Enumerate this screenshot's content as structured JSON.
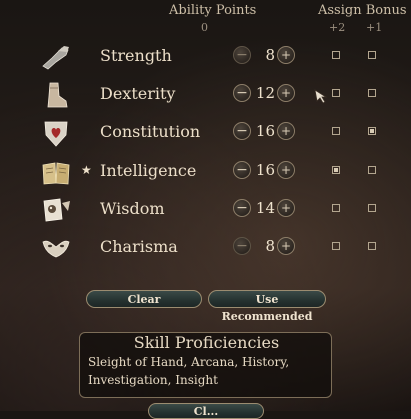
{
  "header": {
    "ability_points_label": "Ability Points",
    "ability_points_value": "0",
    "assign_bonus_label": "Assign Bonus",
    "bonus_plus2": "+2",
    "bonus_plus1": "+1"
  },
  "abilities": [
    {
      "name": "Strength",
      "score": "8",
      "icon": "gauntlet-icon",
      "star": "",
      "minus": "−",
      "plus": "+",
      "bonus2": false,
      "bonus1": false
    },
    {
      "name": "Dexterity",
      "score": "12",
      "icon": "boot-icon",
      "star": "",
      "minus": "−",
      "plus": "+",
      "bonus2": false,
      "bonus1": false
    },
    {
      "name": "Constitution",
      "score": "16",
      "icon": "heart-shield-icon",
      "star": "",
      "minus": "−",
      "plus": "+",
      "bonus2": false,
      "bonus1": true
    },
    {
      "name": "Intelligence",
      "score": "16",
      "icon": "open-book-icon",
      "star": "★",
      "minus": "−",
      "plus": "+",
      "bonus2": true,
      "bonus1": false
    },
    {
      "name": "Wisdom",
      "score": "14",
      "icon": "owl-scroll-icon",
      "star": "",
      "minus": "−",
      "plus": "+",
      "bonus2": false,
      "bonus1": false
    },
    {
      "name": "Charisma",
      "score": "8",
      "icon": "mask-icon",
      "star": "",
      "minus": "−",
      "plus": "+",
      "bonus2": false,
      "bonus1": false
    }
  ],
  "buttons": {
    "clear": "Clear",
    "use_recommended": "Use Recommended",
    "bottom_partial": "Cl..."
  },
  "skills": {
    "title": "Skill Proficiencies",
    "list": "Sleight of Hand, Arcana, History, Investigation, Insight"
  },
  "colors": {
    "background": "#231c18",
    "text": "#ecdfc9",
    "pill": "#253230",
    "pill_border": "#9b8c70"
  }
}
